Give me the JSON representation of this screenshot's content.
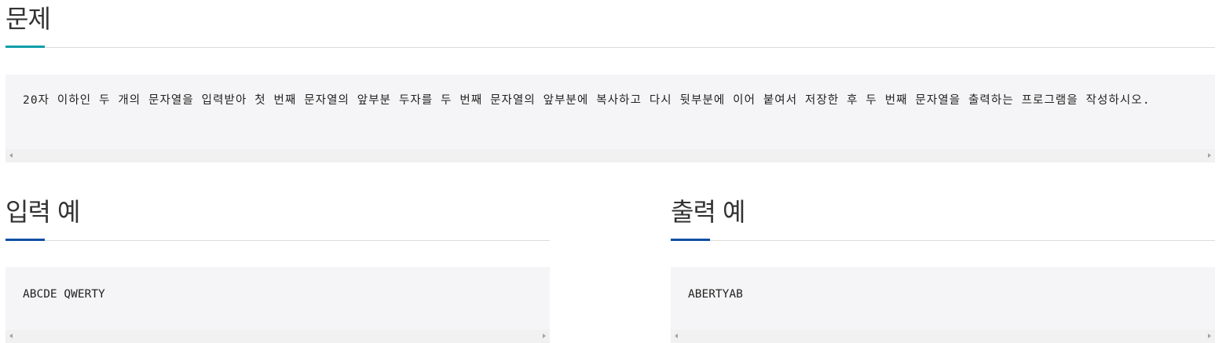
{
  "problem": {
    "title": "문제",
    "text": "20자 이하인 두 개의 문자열을 입력받아 첫 번째 문자열의 앞부분 두자를 두 번째 문자열의 앞부분에 복사하고 다시 뒷부분에 이어 붙여서 저장한 후 두 번째 문자열을 출력하는 프로그램을 작성하시오."
  },
  "input_example": {
    "title": "입력 예",
    "text": "ABCDE QWERTY"
  },
  "output_example": {
    "title": "출력 예",
    "text": "ABERTYAB"
  },
  "colors": {
    "problem_accent": "#0d9ea8",
    "example_accent": "#0e4fa3",
    "code_background": "#f5f5f7"
  }
}
